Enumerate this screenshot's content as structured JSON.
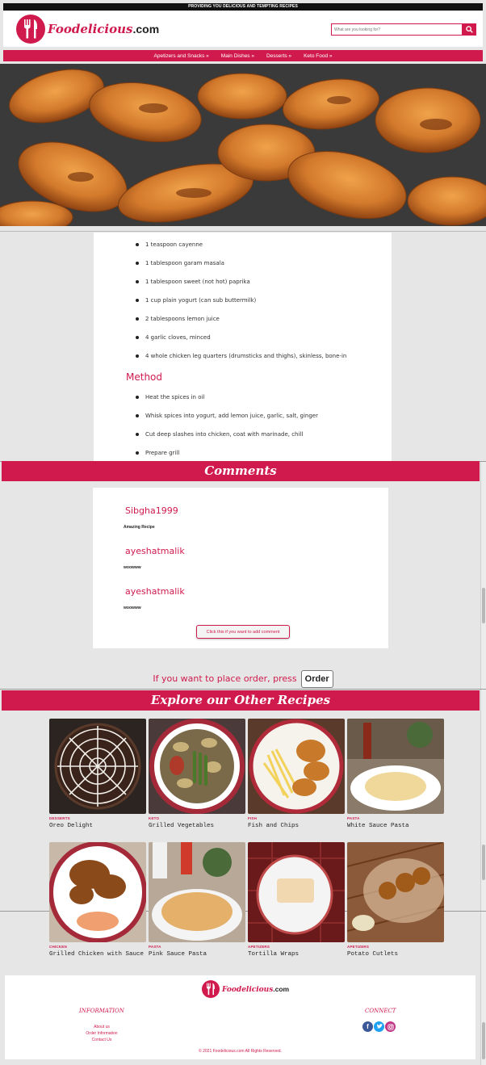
{
  "topbar": {
    "tagline": "PROVIDING YOU DELICIOUS AND TEMPTING RECIPES"
  },
  "brand": {
    "name": "Foodelicious",
    "suffix": ".com",
    "accent": "#d01a4e"
  },
  "search": {
    "placeholder": "What are you looking for?"
  },
  "nav": {
    "items": [
      "Apetizers and Snacks »",
      "Main Dishes »",
      "Desserts »",
      "Keto Food »"
    ]
  },
  "recipe": {
    "ingredients": [
      "1 teaspoon cayenne",
      "1 tablespoon garam masala",
      "1 tablespoon sweet (not hot) paprika",
      "1 cup plain yogurt (can sub buttermilk)",
      "2 tablespoons lemon juice",
      "4 garlic cloves, minced",
      "4 whole chicken leg quarters (drumsticks and thighs), skinless, bone-in"
    ],
    "method_title": "Method",
    "steps": [
      "Heat the spices in oil",
      "Whisk spices into yogurt, add lemon juice, garlic, salt, ginger",
      "Cut deep slashes into chicken, coat with marinade, chill",
      "Prepare grill"
    ]
  },
  "comments": {
    "title": "Comments",
    "items": [
      {
        "user": "Sibgha1999",
        "text": "Amazing Recipe"
      },
      {
        "user": "ayeshatmalik",
        "text": "woowww"
      },
      {
        "user": "ayeshatmalik",
        "text": "woowww"
      }
    ],
    "add_button": "Click this if you want to add comment"
  },
  "order": {
    "prompt": "If you want to place order, press",
    "button": "Order"
  },
  "explore": {
    "title": "Explore our Other Recipes",
    "recipes": [
      {
        "category": "DESSERTS",
        "name": "Oreo Delight"
      },
      {
        "category": "KETO",
        "name": "Grilled Vegetables"
      },
      {
        "category": "FISH",
        "name": "Fish and Chips"
      },
      {
        "category": "PASTA",
        "name": "White Sauce Pasta"
      },
      {
        "category": "CHICKEN",
        "name": "Grilled Chicken with Sauce"
      },
      {
        "category": "PASTA",
        "name": "Pink Sauce Pasta"
      },
      {
        "category": "APETIZERS",
        "name": "Tortilla Wraps"
      },
      {
        "category": "APETIZERS",
        "name": "Potato Cutlets"
      }
    ]
  },
  "footer": {
    "info_title": "INFORMATION",
    "links": [
      "About us",
      "Order Information",
      "Contact Us"
    ],
    "connect_title": "CONNECT",
    "socials": [
      "facebook-icon",
      "twitter-icon",
      "instagram-icon"
    ],
    "copyright": "© 2021 Foodelicious.com All Rights Reserved."
  }
}
